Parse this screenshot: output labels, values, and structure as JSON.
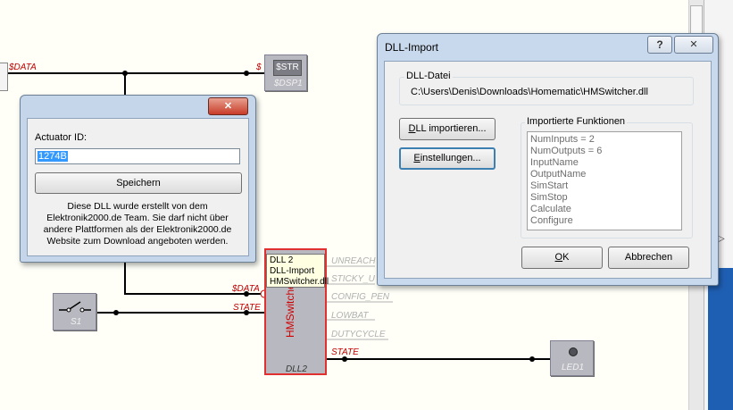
{
  "canvas": {
    "pins": {
      "data_left": "$DATA",
      "dollar": "$",
      "data_right": "$DATA",
      "state_in": "STATE",
      "unreach": "UNREACH",
      "sticky": "STICKY_U",
      "config_pen": "CONFIG_PEN",
      "lowbat": "LOWBAT",
      "dutycycle": "DUTYCYCLE",
      "state_out": "STATE"
    },
    "components": {
      "dsp_text": "$STR",
      "dsp_name": "$DSP1",
      "switch_name": "S1",
      "dll_title": "HMSwitcher",
      "dll_name": "DLL2",
      "led_name": "LED1"
    },
    "tooltip": {
      "line1": "DLL 2",
      "line2": "DLL-Import",
      "line3": "HMSwitcher.dll"
    }
  },
  "actuator_dialog": {
    "close_symbol": "✕",
    "label": "Actuator ID:",
    "input_value": "1274B",
    "save_button": "Speichern",
    "info": "Diese DLL wurde erstellt von dem Elektronik2000.de Team. Sie darf nicht über andere Plattformen als der Elektronik2000.de Website zum Download angeboten werden."
  },
  "dll_dialog": {
    "title": "DLL-Import",
    "help_symbol": "?",
    "close_symbol": "✕",
    "file_group_title": "DLL-Datei",
    "file_path": "C:\\Users\\Denis\\Downloads\\Homematic\\HMSwitcher.dll",
    "import_button": "DLL importieren...",
    "settings_button": "Einstellungen...",
    "functions_title": "Importierte Funktionen",
    "functions": [
      "NumInputs = 2",
      "NumOutputs = 6",
      "InputName",
      "OutputName",
      "SimStart",
      "SimStop",
      "Calculate",
      "Configure"
    ],
    "ok_button": "OK",
    "cancel_button": "Abbrechen"
  },
  "colors": {
    "accent_red": "#c00000",
    "selection_blue": "#3399ff",
    "side_panel_blue": "#1f5fb3"
  }
}
